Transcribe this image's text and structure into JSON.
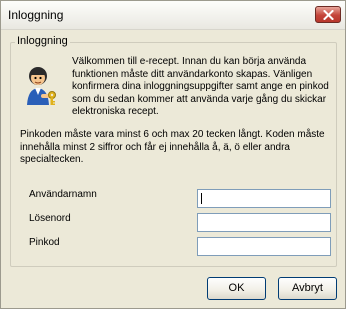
{
  "window": {
    "title": "Inloggning"
  },
  "group": {
    "legend": "Inloggning",
    "intro": "Välkommen till e-recept. Innan du kan börja använda funktionen måste ditt användarkonto skapas. Vänligen konfirmera dina inloggningsuppgifter samt ange en pinkod som du sedan kommer att använda varje gång du skickar elektroniska recept.",
    "rules": "Pinkoden måste vara minst 6 och max 20 tecken långt. Koden måste innehålla minst 2 siffror och får ej innehålla å, ä, ö eller andra specialtecken."
  },
  "fields": {
    "username_label": "Användarnamn",
    "username_value": "",
    "password_label": "Lösenord",
    "password_value": "",
    "pincode_label": "Pinkod",
    "pincode_value": ""
  },
  "buttons": {
    "ok": "OK",
    "cancel": "Avbryt"
  },
  "icons": {
    "close": "close-icon",
    "avatar": "user-key-icon"
  },
  "colors": {
    "close_button": "#c4453a",
    "dialog_background": "#ece9d8",
    "input_border": "#7f9db9"
  }
}
